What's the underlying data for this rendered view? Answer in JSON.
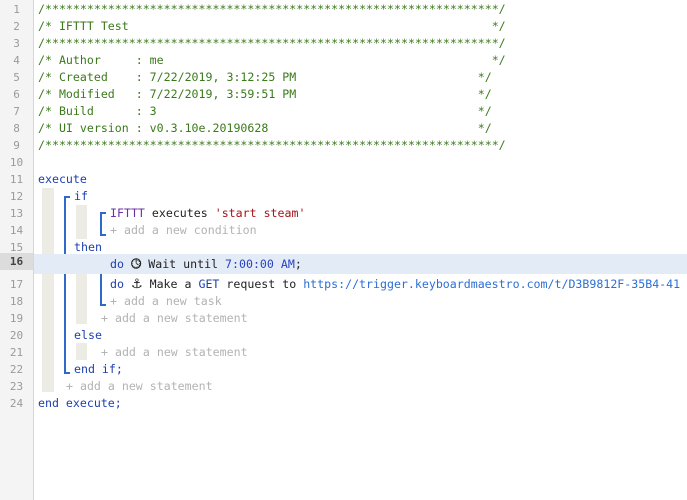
{
  "gutter": {
    "line_numbers": [
      "1",
      "2",
      "3",
      "4",
      "5",
      "6",
      "7",
      "8",
      "9",
      "10",
      "11",
      "12",
      "13",
      "14",
      "15",
      "16",
      "17",
      "18",
      "19",
      "20",
      "21",
      "22",
      "23",
      "24"
    ],
    "active_line": "16"
  },
  "header": {
    "border": "/*****************************************************************/",
    "title": "/* IFTTT Test                                                    */",
    "author": "/* Author     : me                                               */",
    "created": "/* Created    : 7/22/2019, 3:12:25 PM                          */",
    "modified": "/* Modified   : 7/22/2019, 3:59:51 PM                          */",
    "build": "/* Build      : 3                                              */",
    "ui_version": "/* UI version : v0.3.10e.20190628                              */"
  },
  "code": {
    "execute": "execute",
    "if": "if",
    "condition_device": "IFTTT",
    "condition_verb": "executes",
    "condition_value": "'start steam'",
    "add_condition": "+ add a new condition",
    "then": "then",
    "do": "do",
    "task1_text": "Wait until",
    "task1_time": "7:00:00 AM",
    "task1_end": ";",
    "task2_text_a": "Make a",
    "task2_method": "GET",
    "task2_text_b": "request to",
    "task2_url": "https://trigger.keyboardmaestro.com/t/D3B9812F-35B4-41",
    "add_task": "+ add a new task",
    "add_statement": "+ add a new statement",
    "else": "else",
    "end_if": "end if;",
    "end_execute": "end execute;"
  },
  "icons": {
    "clock": "clock-icon",
    "anchor": "anchor-icon"
  },
  "colors": {
    "comment": "#3b7a1b",
    "keyword": "#1b3fb0",
    "string": "#a3141b",
    "link": "#2b6fd4",
    "placeholder": "#b3b3b3"
  }
}
